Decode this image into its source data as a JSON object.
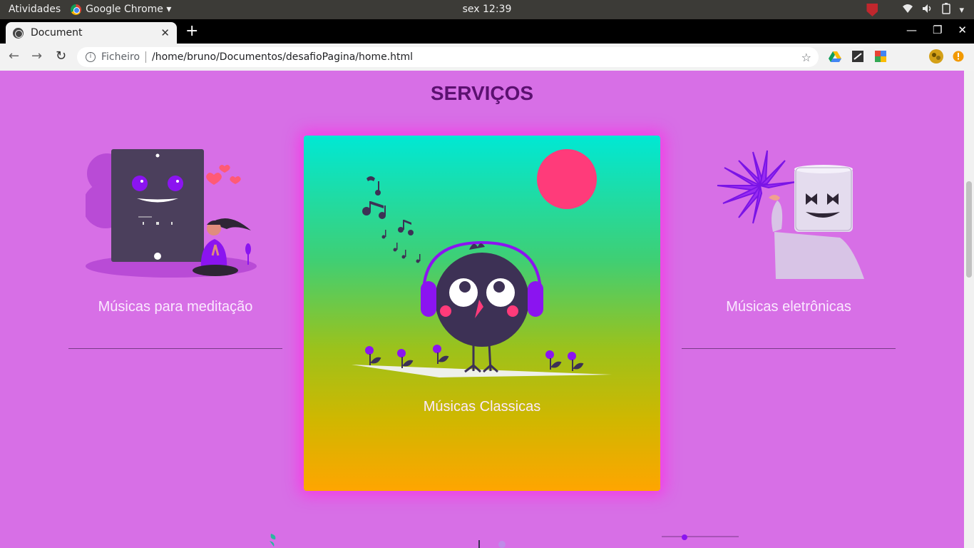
{
  "system_bar": {
    "activities": "Atividades",
    "app_name": "Google Chrome",
    "clock": "sex 12:39"
  },
  "browser": {
    "tab_title": "Document",
    "address_scheme": "Ficheiro",
    "address_path": "/home/bruno/Documentos/desafioPagina/home.html"
  },
  "page": {
    "section_title": "SERVIÇOS",
    "cards": [
      {
        "label": "Músicas para meditação"
      },
      {
        "label": "Músicas Classicas"
      },
      {
        "label": "Músicas eletrônicas"
      }
    ]
  },
  "colors": {
    "page_background": "#d76fe6",
    "title": "#5b1170",
    "card_label": "#fbe9ff",
    "feature_glow": "#ff28e6"
  },
  "icons": [
    "chrome-icon",
    "shield-icon",
    "wifi-icon",
    "volume-icon",
    "battery-icon",
    "globe-icon",
    "close-icon",
    "plus-icon",
    "minimize-icon",
    "restore-icon",
    "back-icon",
    "forward-icon",
    "reload-icon",
    "info-icon",
    "star-icon",
    "drive-icon",
    "extension-icon",
    "avatar-icon",
    "alert-icon"
  ]
}
